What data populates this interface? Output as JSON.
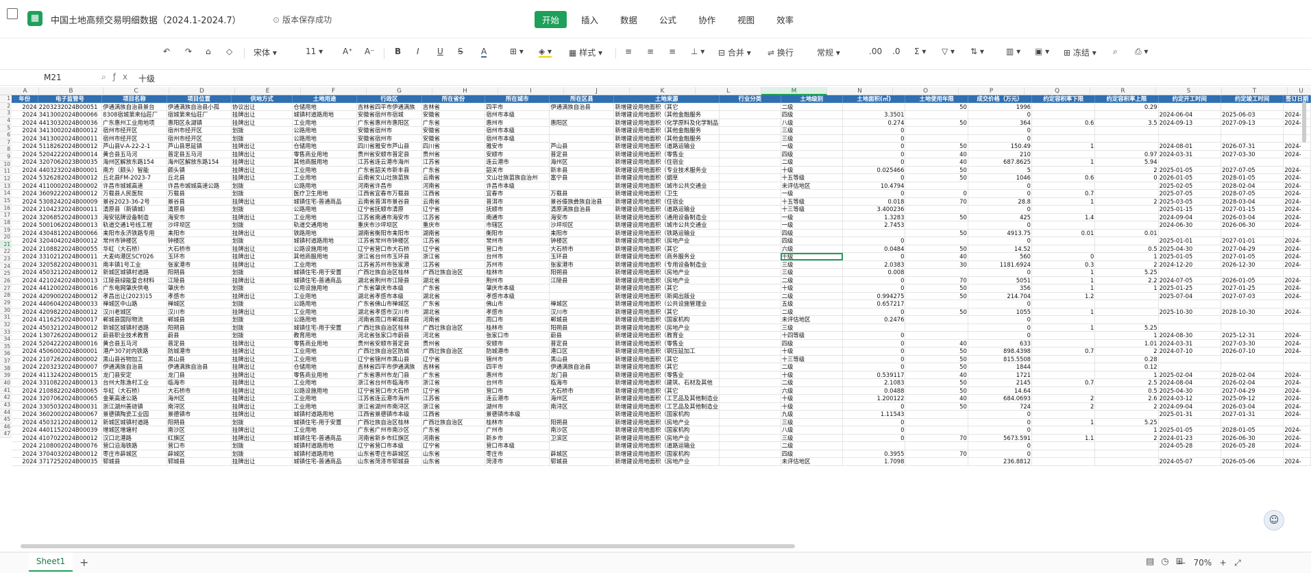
{
  "app": {
    "title": "中国土地高频交易明细数据（2024.1-2024.7）",
    "save_status": "版本保存成功"
  },
  "menu": [
    "开始",
    "插入",
    "数据",
    "公式",
    "协作",
    "视图",
    "效率"
  ],
  "toolbar": {
    "font_name": "宋体",
    "font_size": "11",
    "style_label": "样式",
    "merge_label": "合并",
    "wrap_label": "换行",
    "number_format": "常规",
    "freeze_label": "冻结"
  },
  "formula_bar": {
    "name_box": "M21",
    "value": "十级"
  },
  "columns": [
    "A",
    "B",
    "C",
    "D",
    "E",
    "F",
    "G",
    "H",
    "I",
    "J",
    "K",
    "L",
    "M",
    "N",
    "O",
    "P",
    "Q",
    "R",
    "S",
    "T",
    "U"
  ],
  "selected_column": "M",
  "selected_row": 21,
  "header_row": [
    "年份",
    "电子监管号",
    "项目名称",
    "项目位置",
    "供地方式",
    "土地用途",
    "行政区",
    "所在省份",
    "所在城市",
    "所在区县",
    "土地来源",
    "行业分类",
    "土地级别",
    "土地面积(㎡)",
    "土地使用年限",
    "成交价格（万元）",
    "约定容积率下限",
    "约定容积率上限",
    "约定开工时间",
    "约定竣工时间",
    "签订日期"
  ],
  "rows": [
    [
      "2024",
      "2203232024B00051",
      "伊通满族自治县景台",
      "伊通满族自治县小孤",
      "协议出让",
      "仓储用地",
      "吉林省四平市伊通满族",
      "吉林省",
      "四平市",
      "伊通满族自治县",
      "新增建设用地面积（其它",
      "",
      "二级",
      "",
      "50",
      "1996",
      "",
      "0.29",
      "",
      "",
      ""
    ],
    [
      "2024",
      "3413002024B00066",
      "8308宿城第来仙莊厂",
      "宿城第来仙莊厂",
      "挂牌出让",
      "城镇村道路用地",
      "安徽省宿州市宿城",
      "安徽省",
      "宿州市本级",
      "",
      "新增建设用地面积（其他金融服务",
      "",
      "四级",
      "3.3501",
      "",
      "0",
      "",
      "",
      "2024-06-04",
      "2025-06-03",
      "2024-"
    ],
    [
      "2024",
      "4413032024B00036",
      "广东惠州工业用地项",
      "惠阳区永湖镇",
      "挂牌出让",
      "工业用地",
      "广东省惠州市惠阳区",
      "广东省",
      "惠州市",
      "惠阳区",
      "新增建设用地面积（化学原料及化学制品",
      "",
      "八级",
      "0.274",
      "50",
      "364",
      "0.6",
      "3.5",
      "2024-09-13",
      "2027-09-13",
      "2024-"
    ],
    [
      "2024",
      "3413002024B00012",
      "宿州市经开区",
      "宿州市经开区",
      "划拨",
      "公路用地",
      "安徽省宿州市",
      "安徽省",
      "宿州市本级",
      "",
      "新增建设用地面积（其他金融服务",
      "",
      "三级",
      "0",
      "",
      "0",
      "",
      "",
      "",
      "",
      ""
    ],
    [
      "2024",
      "3413002024B00011",
      "宿州市经开区",
      "宿州市经开区",
      "划拨",
      "公路用地",
      "安徽省宿州市",
      "安徽省",
      "宿州市本级",
      "",
      "新增建设用地面积（其他金融服务",
      "",
      "三级",
      "0",
      "",
      "0",
      "",
      "",
      "",
      "",
      ""
    ],
    [
      "2024",
      "5118262024B00012",
      "芦山县V-A-22-2-1",
      "芦山县思延镇",
      "挂牌出让",
      "仓储用地",
      "四川省雅安市芦山县",
      "四川省",
      "雅安市",
      "芦山县",
      "新增建设用地面积（道路运输业",
      "",
      "一级",
      "0",
      "50",
      "150.49",
      "1",
      "",
      "2024-08-01",
      "2026-07-31",
      "2024-"
    ],
    [
      "2024",
      "5204222024B00014",
      "黄合县五马河",
      "普定县五马河",
      "挂牌出让",
      "零售商业用地",
      "贵州省安顺市普定县",
      "贵州省",
      "安顺市",
      "普定县",
      "新增建设用地面积（零售业",
      "",
      "四级",
      "0",
      "40",
      "210",
      "",
      "0.97",
      "2024-03-31",
      "2027-03-30",
      "2024-"
    ],
    [
      "2024",
      "3207062023B00035",
      "海州区解放东路154",
      "海州区解放东路154",
      "挂牌出让",
      "其他商服用地",
      "江苏省连云港市海州",
      "江苏省",
      "连云港市",
      "海州区",
      "新增建设用地面积（住宿业",
      "",
      "二级",
      "0",
      "40",
      "687.8625",
      "1",
      "5.94",
      "",
      "",
      ""
    ],
    [
      "2024",
      "4403232024B00001",
      "南方（颇头）智能",
      "颇头镇",
      "挂牌出让",
      "工业用地",
      "广东省韶关市新丰县",
      "广东省",
      "韶关市",
      "新丰县",
      "新增建设用地面积（专业技术服务业",
      "",
      "十级",
      "0.025466",
      "50",
      "5",
      "",
      "2",
      "2025-01-05",
      "2027-07-05",
      "2024-"
    ],
    [
      "2024",
      "5326282024B00012",
      "丘北县FM-2023-7",
      "丘北县",
      "挂牌出让",
      "工业用地",
      "云南省文山壮族苗族",
      "云南省",
      "文山壮族苗族自治州",
      "富宁县",
      "新增建设用地面积（烟草",
      "",
      "十五等级",
      "0",
      "50",
      "1046",
      "0.6",
      "0",
      "2026-01-05",
      "2028-01-05",
      "2024-"
    ],
    [
      "2024",
      "4110002024B00002",
      "许昌市城城高速",
      "许昌市城城高速公路",
      "划拨",
      "公路用地",
      "河南省许昌市",
      "河南省",
      "许昌市本级",
      "",
      "新增建设用地面积（城市公共交通业",
      "",
      "未评估地区",
      "10.4794",
      "",
      "0",
      "",
      "",
      "2025-02-05",
      "2028-02-04",
      "2024-"
    ],
    [
      "2024",
      "3609222024B00012",
      "万载县人民医院",
      "万载县",
      "划拨",
      "医疗卫生用地",
      "江西省宜春市万载县",
      "江西省",
      "宜春市",
      "万载县",
      "新增建设用地面积（卫生",
      "",
      "一级",
      "0",
      "0",
      "0",
      "0.7",
      "",
      "2025-07-05",
      "2028-07-05",
      "2024-"
    ],
    [
      "2024",
      "5308242024B00009",
      "景谷2023-36-2号",
      "景谷县",
      "挂牌出让",
      "城镇住宅-普通商品",
      "云南省普洱市景谷县",
      "云南省",
      "普洱市",
      "景谷傣族彝族自治县",
      "新增建设用地面积（住宿业",
      "",
      "十五等级",
      "0.018",
      "70",
      "28.8",
      "1",
      "2",
      "2025-03-05",
      "2028-03-04",
      "2024-"
    ],
    [
      "2024",
      "2104232024B00011",
      "清原县（新镇城）",
      "清原县",
      "划拨",
      "公路用地",
      "辽宁省抚顺市清原",
      "辽宁省",
      "抚顺市",
      "清原满族自治县",
      "新增建设用地面积（道路运输业",
      "",
      "十三等级",
      "3.400236",
      "",
      "0",
      "",
      "",
      "2025-01-15",
      "2027-01-15",
      "2024-"
    ],
    [
      "2024",
      "3206852024B00013",
      "海安铭牌设备制造",
      "海安市",
      "挂牌出让",
      "工业用地",
      "江苏省南通市海安市",
      "江苏省",
      "南通市",
      "海安市",
      "新增建设用地面积（通用设备制造业",
      "",
      "一级",
      "1.3283",
      "50",
      "425",
      "1.4",
      "",
      "2024-09-04",
      "2026-03-04",
      "2024-"
    ],
    [
      "2024",
      "5001062024B00013",
      "轨道交通1号线工程",
      "沙坪坝区",
      "划拨",
      "轨道交通用地",
      "重庆市沙坪坝区",
      "重庆市",
      "市辖区",
      "沙坪坝区",
      "新增建设用地面积（城市公共交通业",
      "",
      "一级",
      "2.7453",
      "",
      "0",
      "",
      "",
      "2024-06-30",
      "2026-06-30",
      "2024-"
    ],
    [
      "2024",
      "4304812024B00066",
      "耒阳市永济铁路专用",
      "耒阳市",
      "挂牌出让",
      "铁路用地",
      "湖南省衡阳市耒阳市",
      "湖南省",
      "衡阳市",
      "耒阳市",
      "新增建设用地面积（铁路运输业",
      "",
      "四级",
      "",
      "50",
      "4913.75",
      "0.01",
      "0.01",
      "",
      "",
      ""
    ],
    [
      "2024",
      "3204042024B00012",
      "常州市钟楼区",
      "钟楼区",
      "划拨",
      "城镇村道路用地",
      "江苏省常州市钟楼区",
      "江苏省",
      "常州市",
      "钟楼区",
      "新增建设用地面积（房地产业",
      "",
      "四级",
      "0",
      "",
      "0",
      "",
      "",
      "2025-01-01",
      "2027-01-01",
      "2024-"
    ],
    [
      "2024",
      "2108822024B00055",
      "华虹（大石桥）",
      "大石桥市",
      "挂牌出让",
      "公路设施用地",
      "辽宁省营口市大石桥",
      "辽宁省",
      "营口市",
      "大石桥市",
      "新增建设用地面积（其它",
      "",
      "六级",
      "0.0484",
      "50",
      "14.52",
      "",
      "0.5",
      "2025-04-30",
      "2027-04-29",
      "2024-"
    ],
    [
      "2024",
      "3310212024B00011",
      "大麦屿港区SCY026",
      "玉环市",
      "挂牌出让",
      "其他商服用地",
      "浙江省台州市玉环县",
      "浙江省",
      "台州市",
      "玉环县",
      "新增建设用地面积（商务服务业",
      "",
      "十级",
      "0",
      "40",
      "560",
      "0",
      "1",
      "2025-01-05",
      "2027-01-05",
      "2024-"
    ],
    [
      "2024",
      "3205822024B00031",
      "南丰镇1号工业",
      "张家港市",
      "挂牌出让",
      "工业用地",
      "江苏省苏州市张家港",
      "江苏省",
      "苏州市",
      "张家港市",
      "新增建设用地面积（专用设备制造业",
      "",
      "三级",
      "2.0383",
      "30",
      "1181.6924",
      "0.3",
      "2",
      "2024-12-20",
      "2026-12-30",
      "2024-"
    ],
    [
      "2024",
      "4503212024B00012",
      "新城区城镇村道路",
      "阳朔县",
      "划拨",
      "城镇住宅-用于安置",
      "广西壮族自治区桂林",
      "广西壮族自治区",
      "桂林市",
      "阳朔县",
      "新增建设用地面积（房地产业",
      "",
      "三级",
      "0.008",
      "",
      "0",
      "1",
      "5.25",
      "",
      "",
      ""
    ],
    [
      "2024",
      "4210242024B00013",
      "江陵县绿能复合材料",
      "江陵县",
      "挂牌出让",
      "城镇住宅-普通商品",
      "湖北省荆州市江陵县",
      "湖北省",
      "荆州市",
      "江陵县",
      "新增建设用地面积（房地产业",
      "",
      "二级",
      "0",
      "70",
      "5051",
      "1",
      "2.2",
      "2024-07-05",
      "2026-01-05",
      "2024-"
    ],
    [
      "2024",
      "4412002024B00016",
      "广东电网肇庆供电",
      "肇庆市",
      "划拨",
      "公用设施用地",
      "广东省肇庆市本级",
      "广东省",
      "肇庆市本级",
      "",
      "新增建设用地面积（其它",
      "",
      "十级",
      "0",
      "50",
      "356",
      "1",
      "1",
      "2025-01-25",
      "2027-01-25",
      "2024-"
    ],
    [
      "2024",
      "4209002024B00012",
      "孝昌出让(2023)15",
      "孝感市",
      "挂牌出让",
      "工业用地",
      "湖北省孝感市本级",
      "湖北省",
      "孝感市本级",
      "",
      "新增建设用地面积（新闻出版业",
      "",
      "二级",
      "0.994275",
      "50",
      "214.704",
      "1.2",
      "",
      "2025-07-04",
      "2027-07-03",
      "2024-"
    ],
    [
      "2024",
      "4406042024B00033",
      "禅城区中山路",
      "禅城区",
      "划拨",
      "公路用地",
      "广东省佛山市禅城区",
      "广东省",
      "佛山市",
      "禅城区",
      "新增建设用地面积（公共设施管理业",
      "",
      "五级",
      "0.657217",
      "",
      "0",
      "",
      "",
      "",
      "",
      ""
    ],
    [
      "2024",
      "4209822024B00012",
      "汉川老城区",
      "汉川市",
      "挂牌出让",
      "工业用地",
      "湖北省孝感市汉川市",
      "湖北省",
      "孝感市",
      "汉川市",
      "新增建设用地面积（其它",
      "",
      "二级",
      "0",
      "50",
      "1055",
      "1",
      "",
      "2025-10-30",
      "2028-10-30",
      "2024-"
    ],
    [
      "2024",
      "4116252024B00017",
      "郸城县国际物流",
      "郸城县",
      "划拨",
      "公路用地",
      "河南省周口市郸城县",
      "河南省",
      "周口市",
      "郸城县",
      "新增建设用地面积（国家机构",
      "",
      "未评估地区",
      "0.2476",
      "",
      "0",
      "",
      "",
      "",
      "",
      ""
    ],
    [
      "2024",
      "4503212024B00012",
      "新城区城镇村道路",
      "阳朔县",
      "划拨",
      "城镇住宅-用于安置",
      "广西壮族自治区桂林",
      "广西壮族自治区",
      "桂林市",
      "阳朔县",
      "新增建设用地面积（房地产业",
      "",
      "三级",
      "",
      "",
      "0",
      "1",
      "5.25",
      "",
      "",
      ""
    ],
    [
      "2024",
      "1307262024B00012",
      "蔚县职业技术教育",
      "蔚县",
      "划拨",
      "教育用地",
      "河北省张家口市蔚县",
      "河北省",
      "张家口市",
      "蔚县",
      "新增建设用地面积（教育业",
      "",
      "十四等级",
      "0",
      "",
      "0",
      "",
      "1",
      "2024-08-30",
      "2025-12-31",
      "2024-"
    ],
    [
      "2024",
      "5204222024B00016",
      "黄合县五马河",
      "普定县",
      "挂牌出让",
      "零售商业用地",
      "贵州省安顺市普定县",
      "贵州省",
      "安顺市",
      "普定县",
      "新增建设用地面积（零售业",
      "",
      "四级",
      "0",
      "40",
      "633",
      "",
      "1.01",
      "2024-03-31",
      "2027-03-30",
      "2024-"
    ],
    [
      "2024",
      "4506002024B00001",
      "港产307对内铁路",
      "防城港市",
      "挂牌出让",
      "工业用地",
      "广西壮族自治区防城",
      "广西壮族自治区",
      "防城港市",
      "港口区",
      "新增建设用地面积（钢压延加工",
      "",
      "十级",
      "0",
      "50",
      "898.4398",
      "0.7",
      "2",
      "2024-07-10",
      "2026-07-10",
      "2024-"
    ],
    [
      "2024",
      "2107262024B00002",
      "黑山县谷物加工",
      "黑山县",
      "挂牌出让",
      "工业用地",
      "辽宁省锦州市黑山县",
      "辽宁省",
      "锦州市",
      "黑山县",
      "新增建设用地面积（其它",
      "",
      "十三等级",
      "0",
      "50",
      "815.5508",
      "",
      "0.28",
      "",
      "",
      ""
    ],
    [
      "2024",
      "2203232024B00007",
      "伊通满族自治县",
      "伊通满族自治县",
      "挂牌出让",
      "仓储用地",
      "吉林省四平市伊通满族",
      "吉林省",
      "四平市",
      "伊通满族自治县",
      "新增建设用地面积（其它",
      "",
      "二级",
      "0",
      "50",
      "1844",
      "",
      "0.12",
      "",
      "",
      ""
    ],
    [
      "2024",
      "4113242024B00015",
      "龙门县安定",
      "龙门县",
      "挂牌出让",
      "零售商业用地",
      "广东省惠州市龙门县",
      "广东省",
      "惠州市",
      "龙门县",
      "新增建设用地面积（零售业",
      "",
      "十级",
      "0.539117",
      "40",
      "1721",
      "",
      "1",
      "2025-02-04",
      "2028-02-04",
      "2024-"
    ],
    [
      "2024",
      "3310822024B00013",
      "台州大陈渔村工业",
      "临海市",
      "挂牌出让",
      "工业用地",
      "浙江省台州市临海市",
      "浙江省",
      "台州市",
      "临海市",
      "新增建设用地面积（建筑、石材及其他",
      "",
      "二级",
      "2.1083",
      "50",
      "2145",
      "0.7",
      "2.5",
      "2024-08-04",
      "2026-02-04",
      "2024-"
    ],
    [
      "2024",
      "2108822024B00065",
      "华虹（大石桥）",
      "大石桥市",
      "挂牌出让",
      "公路设施用地",
      "辽宁省营口市大石桥",
      "辽宁省",
      "营口市",
      "大石桥市",
      "新增建设用地面积（其它",
      "",
      "六级",
      "0.0488",
      "50",
      "14.64",
      "",
      "0.5",
      "2025-04-30",
      "2027-04-29",
      "2024-"
    ],
    [
      "2024",
      "3207062024B00065",
      "金莱高速公路",
      "海州区",
      "挂牌出让",
      "工业用地",
      "江苏省连云港市海州",
      "江苏省",
      "连云港市",
      "海州区",
      "新增建设用地面积（工艺品及其他制造业",
      "",
      "十级",
      "1.200122",
      "40",
      "684.0693",
      "2",
      "2.6",
      "2024-03-12",
      "2025-09-12",
      "2024-"
    ],
    [
      "2024",
      "3305032024B00031",
      "浙江湖州善琏镇",
      "南浔区",
      "挂牌出让",
      "工业用地",
      "浙江省湖州市南浔区",
      "浙江省",
      "湖州市",
      "南浔区",
      "新增建设用地面积（工艺品及其他制造业",
      "",
      "十级",
      "0",
      "50",
      "724",
      "2",
      "2",
      "2024-09-04",
      "2026-03-04",
      "2024-"
    ],
    [
      "2024",
      "3602002024B00067",
      "景德镇陶瓷工业园",
      "景德镇市",
      "挂牌出让",
      "城镇村道路用地",
      "江西省景德镇市本级",
      "江西省",
      "景德镇市本级",
      "",
      "新增建设用地面积（国家机构",
      "",
      "九级",
      "1.11543",
      "",
      "0",
      "",
      "",
      "2025-01-31",
      "2027-01-31",
      "2024-"
    ],
    [
      "2024",
      "4503212024B00012",
      "新城区城镇村道路",
      "阳朔县",
      "划拨",
      "城镇住宅-用于安置",
      "广西壮族自治区桂林",
      "广西壮族自治区",
      "桂林市",
      "阳朔县",
      "新增建设用地面积（房地产业",
      "",
      "三级",
      "0",
      "",
      "0",
      "1",
      "5.25",
      "",
      "",
      ""
    ],
    [
      "2024",
      "4401152024B00039",
      "增城区增塘村",
      "南沙区",
      "挂牌出让",
      "工业用地",
      "广东省广州市南沙区",
      "广东省",
      "广州市",
      "南沙区",
      "新增建设用地面积（国家机构",
      "",
      "八级",
      "0",
      "",
      "0",
      "",
      "1",
      "2025-01-05",
      "2028-01-05",
      "2024-"
    ],
    [
      "2024",
      "4107022024B00012",
      "汉口北港路",
      "红旗区",
      "挂牌出让",
      "城镇住宅-普通商品",
      "河南省新乡市红旗区",
      "河南省",
      "新乡市",
      "卫滨区",
      "新增建设用地面积（房地产业",
      "",
      "三级",
      "0",
      "70",
      "5673.591",
      "1.1",
      "2",
      "2024-01-23",
      "2026-06-30",
      "2024-"
    ],
    [
      "2024",
      "2108002024B00076",
      "营口沿海铁路",
      "营口市",
      "划拨",
      "城镇村道路用地",
      "辽宁省营口市本级",
      "辽宁省",
      "营口市本级",
      "",
      "新增建设用地面积（道路运输业",
      "",
      "二级",
      "",
      "",
      "0",
      "",
      "",
      "2024-05-28",
      "2026-05-28",
      "2024-"
    ],
    [
      "2024",
      "3704032024B00012",
      "枣庄市薛城区",
      "薛城区",
      "划拨",
      "城镇村道路用地",
      "山东省枣庄市薛城区",
      "山东省",
      "枣庄市",
      "薛城区",
      "新增建设用地面积（国家机构",
      "",
      "四级",
      "0.3955",
      "70",
      "0",
      "",
      "",
      "",
      "",
      ""
    ],
    [
      "2024",
      "3717252024B00035",
      "郓城县",
      "郓城县",
      "挂牌出让",
      "城镇住宅-普通商品",
      "山东省菏泽市郓城县",
      "山东省",
      "菏泽市",
      "郓城县",
      "新增建设用地面积（房地产业",
      "",
      "未评估地区",
      "1.7098",
      "",
      "236.8812",
      "",
      "",
      "2024-05-07",
      "2026-05-06",
      "2024-"
    ]
  ],
  "sheet_tab": "Sheet1",
  "status": {
    "zoom": "70%"
  }
}
